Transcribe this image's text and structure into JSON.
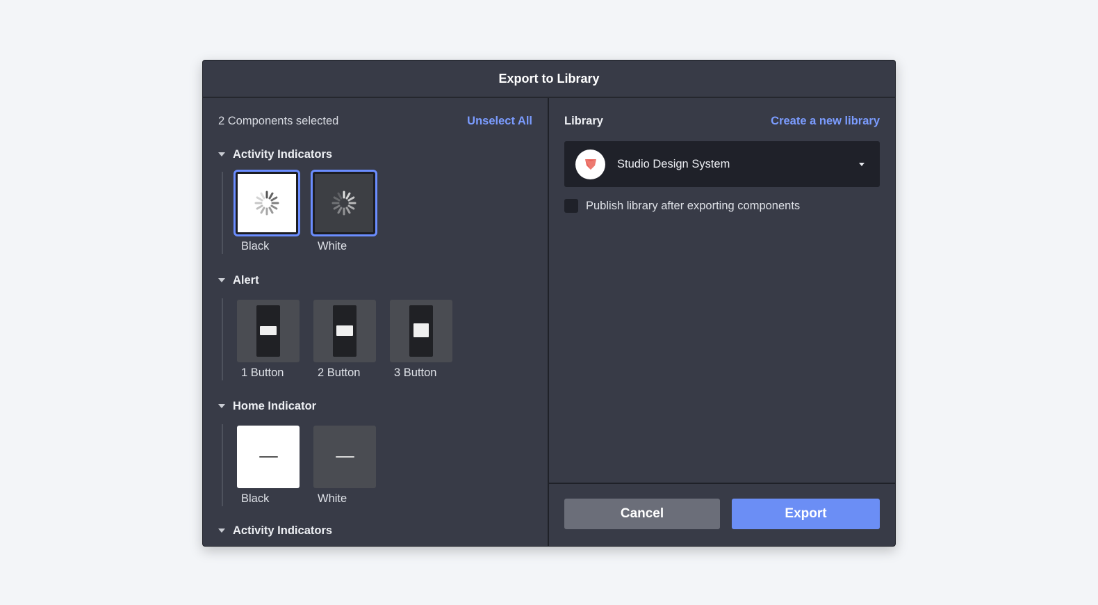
{
  "dialog": {
    "title": "Export to Library"
  },
  "left": {
    "selected_count": "2 Components selected",
    "unselect_all": "Unselect All",
    "groups": [
      {
        "title": "Activity Indicators",
        "items": [
          {
            "label": "Black",
            "selected": true,
            "theme": "light"
          },
          {
            "label": "White",
            "selected": true,
            "theme": "dark"
          }
        ]
      },
      {
        "title": "Alert",
        "items": [
          {
            "label": "1 Button",
            "selected": false
          },
          {
            "label": "2 Button",
            "selected": false
          },
          {
            "label": "3 Button",
            "selected": false
          }
        ]
      },
      {
        "title": "Home Indicator",
        "items": [
          {
            "label": "Black",
            "selected": false,
            "theme": "light"
          },
          {
            "label": "White",
            "selected": false,
            "theme": "dark"
          }
        ]
      },
      {
        "title": "Activity Indicators",
        "items": []
      }
    ]
  },
  "right": {
    "library_label": "Library",
    "create_new": "Create a new library",
    "selected_library": "Studio Design System",
    "publish_label": "Publish library after exporting components",
    "publish_checked": false
  },
  "footer": {
    "cancel": "Cancel",
    "export": "Export"
  },
  "colors": {
    "accent": "#6b8ef5",
    "link": "#7b9cff",
    "dialog_bg": "#383b47",
    "logo_red": "#e8625a"
  }
}
